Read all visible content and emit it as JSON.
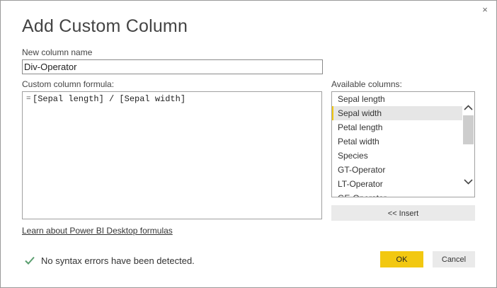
{
  "dialog": {
    "title": "Add Custom Column",
    "close_label": "×"
  },
  "name_field": {
    "label": "New column name",
    "value": "Div-Operator"
  },
  "formula": {
    "label": "Custom column formula:",
    "prefix": "=",
    "text": "[Sepal length] / [Sepal width]"
  },
  "available_columns": {
    "label": "Available columns:",
    "items": [
      {
        "label": "Sepal length",
        "selected": false
      },
      {
        "label": "Sepal width",
        "selected": true
      },
      {
        "label": "Petal length",
        "selected": false
      },
      {
        "label": "Petal width",
        "selected": false
      },
      {
        "label": "Species",
        "selected": false
      },
      {
        "label": "GT-Operator",
        "selected": false
      },
      {
        "label": "LT-Operator",
        "selected": false
      },
      {
        "label": "GE-Operator",
        "selected": false
      }
    ],
    "insert_label": "<< Insert"
  },
  "learn_link": "Learn about Power BI Desktop formulas",
  "status": {
    "message": "No syntax errors have been detected.",
    "icon": "checkmark-icon",
    "icon_color": "#5a9e6f"
  },
  "buttons": {
    "ok_label": "OK",
    "cancel_label": "Cancel"
  },
  "colors": {
    "accent": "#f2c811",
    "selected_row": "#e6e6e6",
    "button_gray": "#eaeaea"
  }
}
